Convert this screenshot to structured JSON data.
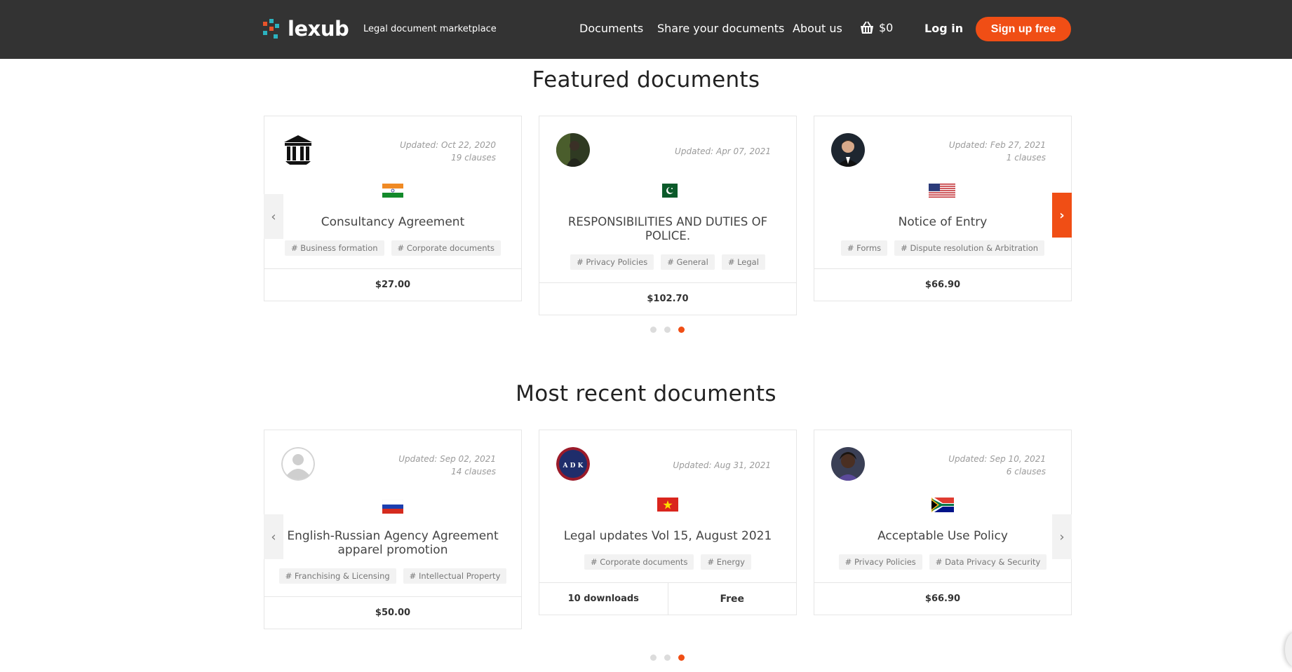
{
  "header": {
    "brand": "lexub",
    "tagline": "Legal document marketplace",
    "nav": {
      "documents": "Documents",
      "share": "Share your documents",
      "about": "About us"
    },
    "cart_amount": "$0",
    "login": "Log in",
    "signup": "Sign up free"
  },
  "featured": {
    "title": "Featured documents",
    "cards": [
      {
        "updated": "Updated: Oct 22, 2020",
        "clauses": "19 clauses",
        "title": "Consultancy Agreement",
        "tags": [
          "# Business formation",
          "# Corporate documents"
        ],
        "price": "$27.00",
        "flag": "India",
        "avatar": "institution-icon"
      },
      {
        "updated": "Updated: Apr 07, 2021",
        "title": "RESPONSIBILITIES AND DUTIES OF POLICE.",
        "tags": [
          "# Privacy Policies",
          "# General",
          "# Legal"
        ],
        "price": "$102.70",
        "flag": "Pakistan",
        "avatar": "user-photo"
      },
      {
        "updated": "Updated: Feb 27, 2021",
        "clauses": "1 clauses",
        "title": "Notice of Entry",
        "tags": [
          "# Forms",
          "# Dispute resolution & Arbitration"
        ],
        "price": "$66.90",
        "flag": "United States",
        "avatar": "user-photo"
      }
    ],
    "prev": "‹",
    "next": "›",
    "active_page": 3
  },
  "recent": {
    "title": "Most recent documents",
    "cards": [
      {
        "updated": "Updated: Sep 02, 2021",
        "clauses": "14 clauses",
        "title": "English-Russian Agency Agreement apparel promotion",
        "tags": [
          "# Franchising & Licensing",
          "# Intellectual Property"
        ],
        "price": "$50.00",
        "flag": "Russia",
        "avatar": "default-user-icon"
      },
      {
        "updated": "Updated: Aug 31, 2021",
        "title": "Legal updates Vol 15, August 2021",
        "tags": [
          "# Corporate documents",
          "# Energy"
        ],
        "downloads": "10 downloads",
        "price": "Free",
        "flag": "Vietnam",
        "avatar": "firm-logo",
        "avatar_text": "A D K"
      },
      {
        "updated": "Updated: Sep 10, 2021",
        "clauses": "6 clauses",
        "title": "Acceptable Use Policy",
        "tags": [
          "# Privacy Policies",
          "# Data Privacy & Security"
        ],
        "price": "$66.90",
        "flag": "South Africa",
        "avatar": "user-photo"
      }
    ],
    "prev": "‹",
    "next": "›",
    "active_page": 3
  },
  "colors": {
    "header_bg": "#333333",
    "accent": "#f04e15"
  }
}
